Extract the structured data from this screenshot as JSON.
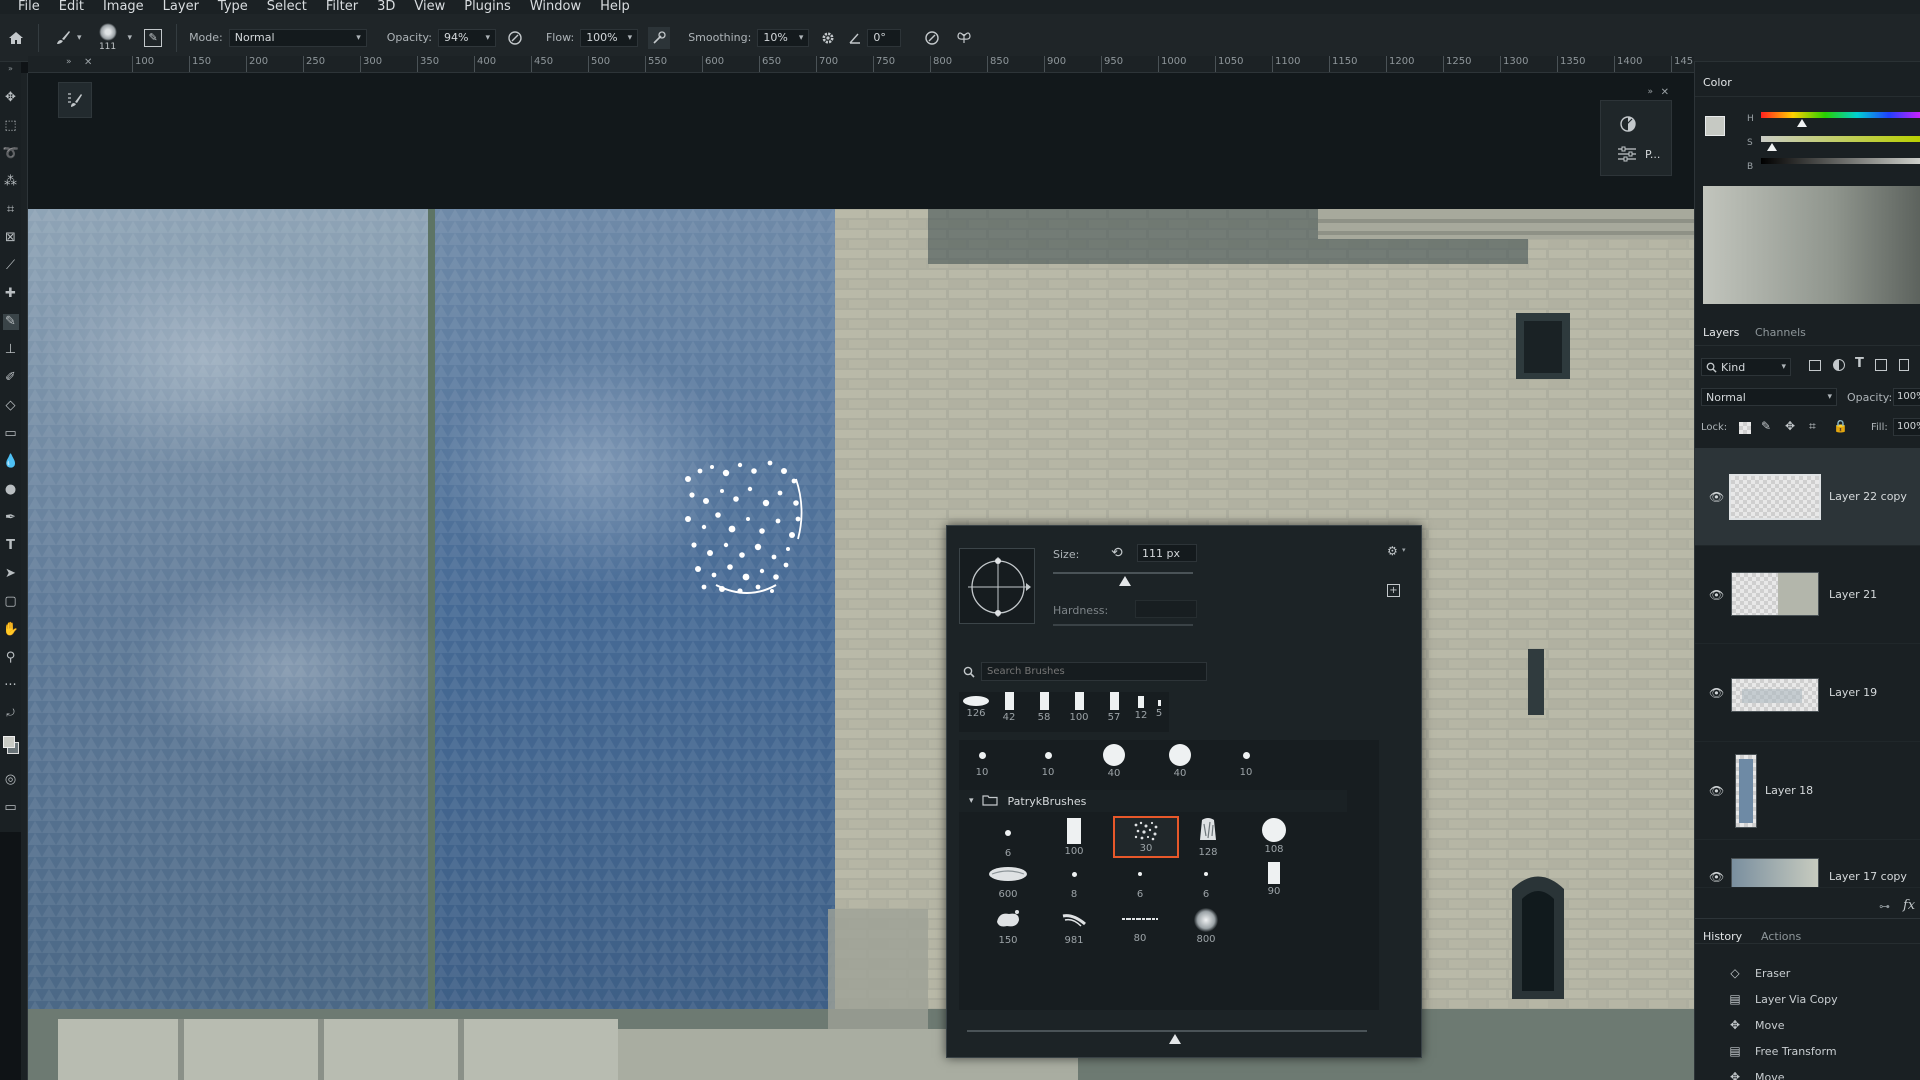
{
  "menu": [
    "File",
    "Edit",
    "Image",
    "Layer",
    "Type",
    "Select",
    "Filter",
    "3D",
    "View",
    "Plugins",
    "Window",
    "Help"
  ],
  "options": {
    "brush_size": "111",
    "mode_label": "Mode:",
    "mode_value": "Normal",
    "opacity_label": "Opacity:",
    "opacity_value": "94%",
    "flow_label": "Flow:",
    "flow_value": "100%",
    "smoothing_label": "Smoothing:",
    "smoothing_value": "10%",
    "angle_value": "0°"
  },
  "ruler_ticks": [
    "100",
    "150",
    "200",
    "250",
    "300",
    "350",
    "400",
    "450",
    "500",
    "550",
    "600",
    "650",
    "700",
    "750",
    "800",
    "850",
    "900",
    "950",
    "1000",
    "1050",
    "1100",
    "1150",
    "1200",
    "1250",
    "1300",
    "1350",
    "1400",
    "145"
  ],
  "float_panel": {
    "label": "P..."
  },
  "brush_picker": {
    "size_label": "Size:",
    "size_value": "111 px",
    "hardness_label": "Hardness:",
    "search_placeholder": "Search Brushes",
    "recent_sizes": [
      "126",
      "42",
      "58",
      "100",
      "57",
      "12",
      "5"
    ],
    "general_sizes": [
      "10",
      "10",
      "40",
      "40",
      "10"
    ],
    "folder_name": "PatrykBrushes",
    "folder_row1": [
      "6",
      "100",
      "30",
      "128",
      "108"
    ],
    "folder_row2": [
      "600",
      "8",
      "6",
      "6",
      "90"
    ],
    "folder_row3": [
      "150",
      "981",
      "80",
      "800"
    ]
  },
  "color_panel": {
    "title": "Color",
    "h": "H",
    "s": "S",
    "b": "B"
  },
  "layers_panel": {
    "tab_layers": "Layers",
    "tab_channels": "Channels",
    "kind": "Kind",
    "blend": "Normal",
    "opacity_label": "Opacity:",
    "opacity_value": "100%",
    "lock_label": "Lock:",
    "fill_label": "Fill:",
    "fill_value": "100%",
    "layers": [
      {
        "name": "Layer 22 copy"
      },
      {
        "name": "Layer 21"
      },
      {
        "name": "Layer 19"
      },
      {
        "name": "Layer 18"
      },
      {
        "name": "Layer 17 copy"
      }
    ]
  },
  "history_panel": {
    "tab_history": "History",
    "tab_actions": "Actions",
    "items": [
      "Eraser",
      "Layer Via Copy",
      "Move",
      "Free Transform",
      "Move"
    ]
  },
  "colors": {
    "accent_selected": "#e8582a",
    "panel_bg": "#1a2023"
  }
}
